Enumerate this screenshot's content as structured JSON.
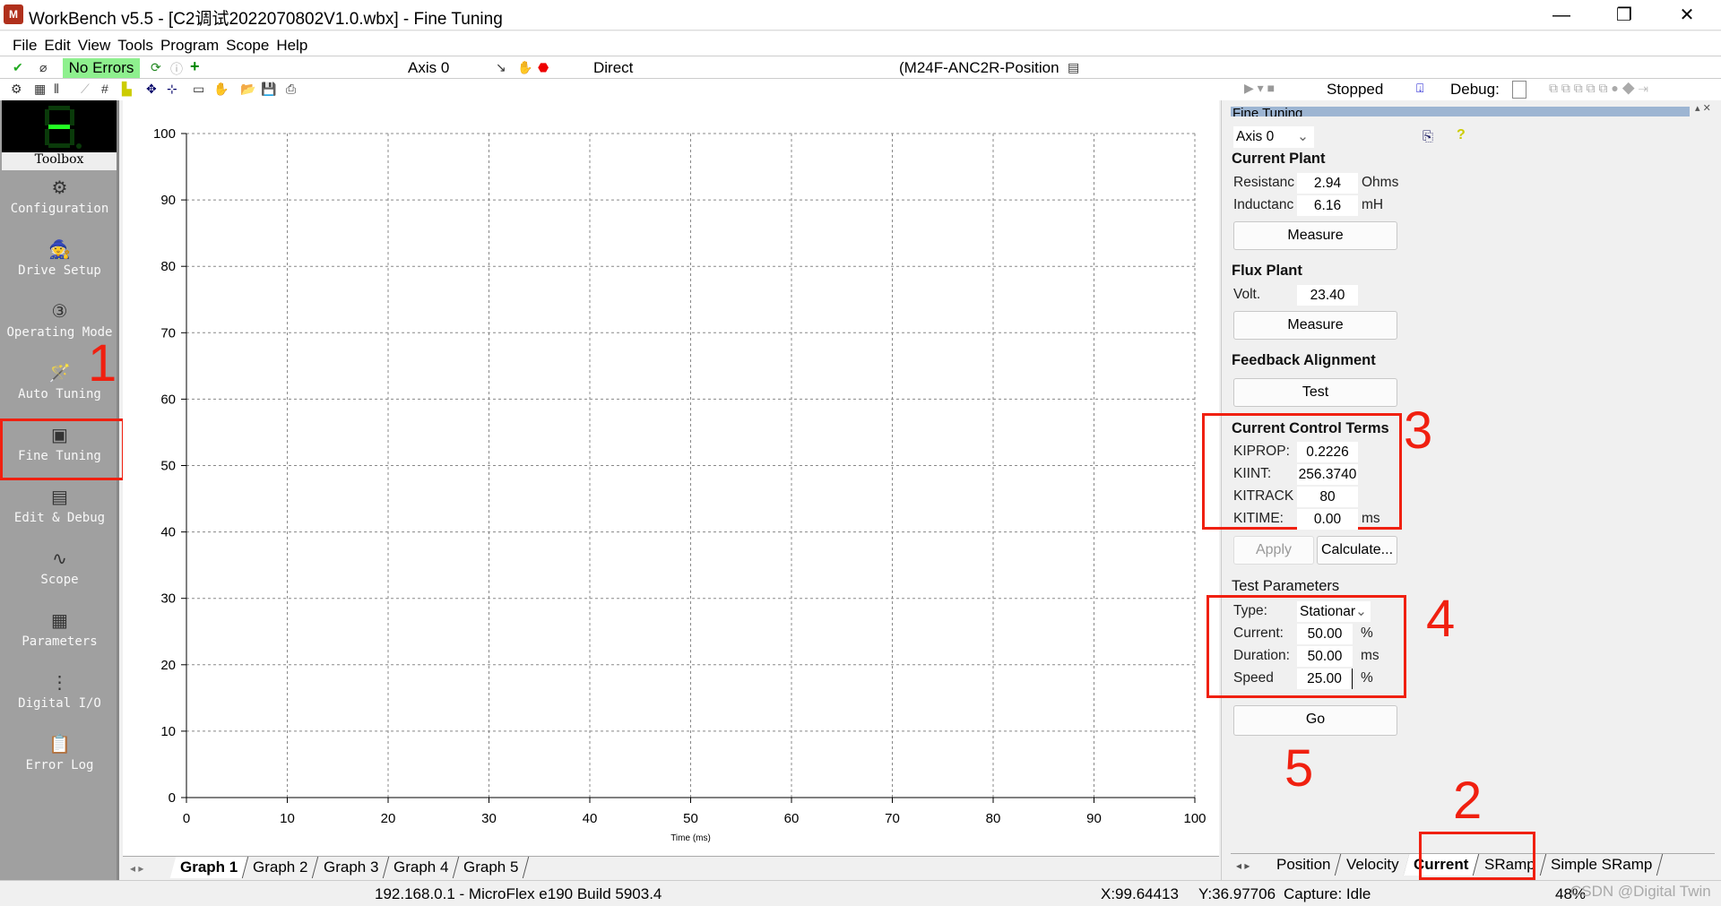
{
  "window": {
    "title": "WorkBench v5.5 - [C2调试2022070802V1.0.wbx] - Fine Tuning",
    "logo": "M",
    "min": "—",
    "max": "❐",
    "close": "✕"
  },
  "menu": [
    "File",
    "Edit",
    "View",
    "Tools",
    "Program",
    "Scope",
    "Help"
  ],
  "toolbar": {
    "status": "No Errors",
    "axis": "Axis 0",
    "mode": "Direct",
    "drive": "(M24F-ANC2R-Position",
    "run_state": "Stopped",
    "debug_label": "Debug:"
  },
  "sidebar": {
    "title": "Toolbox",
    "items": [
      {
        "label": "Configuration",
        "icon": "gear-pencil-icon"
      },
      {
        "label": "Drive Setup",
        "icon": "wizard-hat-icon"
      },
      {
        "label": "Operating Mode",
        "icon": "dial-123-icon"
      },
      {
        "label": "Auto Tuning",
        "icon": "magic-wand-scope-icon"
      },
      {
        "label": "Fine Tuning",
        "icon": "drive-scope-icon"
      },
      {
        "label": "Edit & Debug",
        "icon": "debug-icon"
      },
      {
        "label": "Scope",
        "icon": "scope-icon"
      },
      {
        "label": "Parameters",
        "icon": "parameters-icon"
      },
      {
        "label": "Digital I/O",
        "icon": "digital-io-icon"
      },
      {
        "label": "Error Log",
        "icon": "error-log-icon"
      }
    ]
  },
  "chart_data": {
    "type": "line",
    "series": [],
    "xlabel": "Time (ms)",
    "ylabel": "",
    "xlim": [
      0,
      100
    ],
    "ylim": [
      0,
      100
    ],
    "xticks": [
      0,
      10,
      20,
      30,
      40,
      50,
      60,
      70,
      80,
      90,
      100
    ],
    "yticks": [
      0,
      10,
      20,
      30,
      40,
      50,
      60,
      70,
      80,
      90,
      100
    ],
    "grid": true
  },
  "graph_tabs": [
    "Graph 1",
    "Graph 2",
    "Graph 3",
    "Graph 4",
    "Graph 5"
  ],
  "panel": {
    "title": "Fine Tuning",
    "axis_select": "Axis 0",
    "current_plant": {
      "heading": "Current Plant",
      "resistance_label": "Resistanc",
      "resistance": "2.94",
      "resistance_unit": "Ohms",
      "inductance_label": "Inductanc",
      "inductance": "6.16",
      "inductance_unit": "mH",
      "measure": "Measure"
    },
    "flux_plant": {
      "heading": "Flux Plant",
      "volt_label": "Volt.",
      "volt": "23.40",
      "measure": "Measure"
    },
    "feedback": {
      "heading": "Feedback Alignment",
      "test": "Test"
    },
    "control_terms": {
      "heading": "Current Control Terms",
      "kiprop_label": "KIPROP:",
      "kiprop": "0.2226",
      "kiint_label": "KIINT:",
      "kiint": "256.3740",
      "kitrack_label": "KITRACK",
      "kitrack": "80",
      "kitime_label": "KITIME:",
      "kitime": "0.00",
      "kitime_unit": "ms",
      "apply": "Apply",
      "calculate": "Calculate..."
    },
    "test_params": {
      "heading": "Test Parameters",
      "type_label": "Type:",
      "type": "Stationar",
      "current_label": "Current:",
      "current": "50.00",
      "current_unit": "%",
      "duration_label": "Duration:",
      "duration": "50.00",
      "duration_unit": "ms",
      "speed_label": "Speed",
      "speed": "25.00",
      "speed_unit": "%",
      "go": "Go"
    },
    "tabs": [
      "Position",
      "Velocity",
      "Current",
      "SRamp",
      "Simple SRamp"
    ]
  },
  "annotations": [
    "1",
    "2",
    "3",
    "4",
    "5"
  ],
  "status": {
    "connection": "192.168.0.1 - MicroFlex e190 Build 5903.4",
    "x": "X:99.64413",
    "y": "Y:36.97706",
    "capture": "Capture: Idle",
    "zoom": "48%",
    "watermark": "CSDN @Digital Twin"
  }
}
